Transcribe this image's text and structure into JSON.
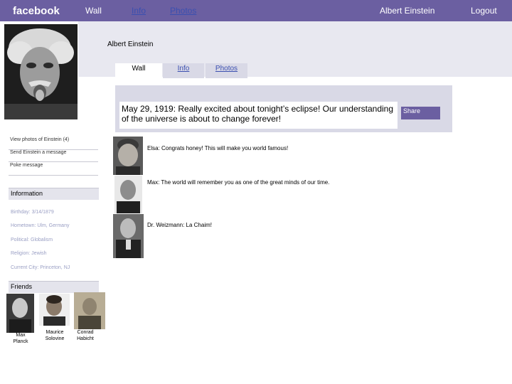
{
  "topbar": {
    "logo": "facebook",
    "nav_wall": "Wall",
    "nav_info": "Info",
    "nav_photos": "Photos",
    "user_name": "Albert Einstein",
    "logout": "Logout"
  },
  "profile": {
    "name": "Albert Einstein"
  },
  "tabs": {
    "wall": "Wall",
    "info": "Info",
    "photos": "Photos"
  },
  "sidebar": {
    "links": [
      "View photos of  Einstein (4)",
      "Send Einstein  a message",
      "Poke message"
    ],
    "information_title": "Information",
    "information": [
      "Birthday: 3/14/1879",
      "Hometown: Ulm, Germany",
      "Political: Globalism",
      "Religion: Jewish",
      "Current City: Princeton, NJ"
    ],
    "friends_title": "Friends",
    "friends": [
      "Max Planck",
      "Maurice Solovine",
      "Conrad Habicht"
    ]
  },
  "status": {
    "text": "May 29, 1919: Really excited about tonight’s eclipse! Our understanding of the universe is about to change forever!",
    "share_label": "Share"
  },
  "comments": [
    "Elsa:  Congrats honey!  This will make you world famous!",
    "Max:  The world will remember you as one of the great minds of our time.",
    "Dr. Weizmann:  La Chaim!"
  ],
  "colors": {
    "topbar": "#6b5fa1",
    "link": "#3b4fb0",
    "panel": "#d9d9e6",
    "info_text": "#9a9fc4"
  }
}
